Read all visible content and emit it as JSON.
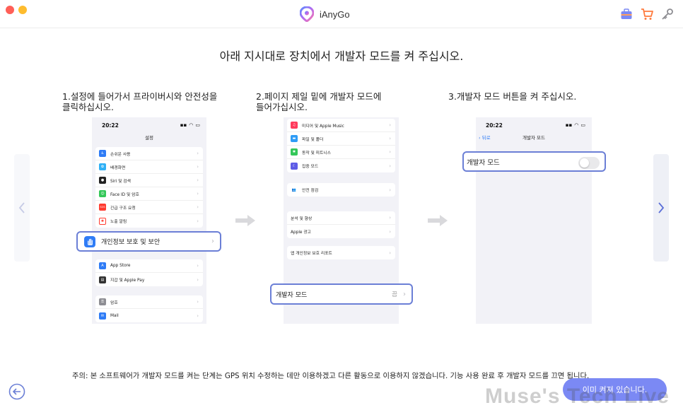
{
  "app": {
    "name": "iAnyGo"
  },
  "heading": "아래 지시대로 장치에서 개발자 모드를 켜 주십시오.",
  "steps": [
    {
      "label_line1": "1.설정에 들어가서 프라이버시와 안전성을",
      "label_line2": "클릭하십시오."
    },
    {
      "label_line1": "2.페이지 제일 밑에 개발자 모드에",
      "label_line2": "들어가십시오."
    },
    {
      "label_line1": "3.개발자 모드 버튼을 켜 주십시오.",
      "label_line2": ""
    }
  ],
  "phone1": {
    "time": "20:22",
    "nav_title": "설정",
    "group1": [
      "손쉬운 사용",
      "배경화면",
      "Siri 및 검색",
      "Face ID 및 암호",
      "긴급 구조 요청",
      "노출 알림"
    ],
    "highlight": "개인정보 보호 및 보안",
    "group2": [
      "App Store",
      "지갑 및 Apple Pay"
    ],
    "group3": [
      "암호",
      "Mail"
    ]
  },
  "phone2": {
    "group1": [
      "미디어 및 Apple Music",
      "파일 및 폴더",
      "동작 및 피트니스",
      "집중 모드"
    ],
    "group2": [
      "안전 점검"
    ],
    "group3": [
      "분석 및 향상",
      "Apple 광고"
    ],
    "group4": [
      "앱 개인정보 보호 리포트"
    ],
    "highlight": "개발자 모드",
    "highlight_value": "끔"
  },
  "phone3": {
    "time": "20:22",
    "back": "뒤로",
    "nav_title": "개발자 모드",
    "highlight": "개발자 모드",
    "toggle_on": false
  },
  "notice": "주의: 본 소프트웨어가 개발자 모드를 켜는 단계는 GPS 위치 수정하는 데만 이용하겠고 다른 활동으로 이용하지 않겠습니다. 기능 사용 완료 후 개발자 모드를 끄면 됩니다.",
  "primary_button": "이미 켜져 있습니다.",
  "watermark": "Muse's Tech Live",
  "colors": {
    "accent": "#7b89f4",
    "highlight_border": "#6b7fd6",
    "ios_blue": "#2f7cf6"
  }
}
